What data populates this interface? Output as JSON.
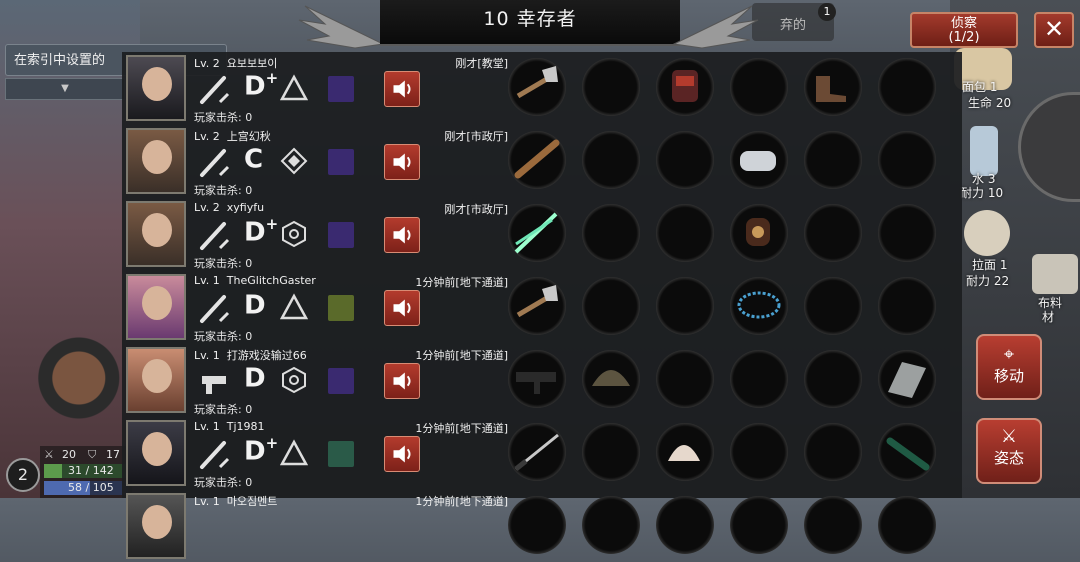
{
  "header": {
    "title": "10 幸存者"
  },
  "search": {
    "placeholder_text": "在索引中设置的",
    "dropdown_glyph": "▼"
  },
  "abandon": {
    "label": "弃的",
    "count": "1"
  },
  "recon": {
    "label": "侦察",
    "count": "(1/2)"
  },
  "close": {
    "glyph": "✕"
  },
  "survivors": [
    {
      "level": "Lv. 2",
      "name": "요보보보이",
      "location": "刚才[教堂]",
      "kills": "玩家击杀: 0",
      "grade": "D",
      "plus": "+",
      "slots": [
        "hatchet",
        "",
        "backpack",
        "",
        "boots",
        ""
      ]
    },
    {
      "level": "Lv. 2",
      "name": "上宫幻秋",
      "location": "刚才[市政厅]",
      "kills": "玩家击杀: 0",
      "grade": "C",
      "plus": "",
      "slots": [
        "bat",
        "",
        "",
        "gauntlet",
        "",
        ""
      ]
    },
    {
      "level": "Lv. 2",
      "name": "xyfiyfu",
      "location": "刚才[市政厅]",
      "kills": "玩家击杀: 0",
      "grade": "D",
      "plus": "+",
      "slots": [
        "lightsaber",
        "",
        "",
        "bracer",
        "",
        ""
      ]
    },
    {
      "level": "Lv. 1",
      "name": "TheGlitchGaster",
      "location": "1分钟前[地下通道]",
      "kills": "玩家击杀: 0",
      "grade": "D",
      "plus": "",
      "slots": [
        "hatchet",
        "",
        "",
        "necklace",
        "",
        ""
      ]
    },
    {
      "level": "Lv. 1",
      "name": "打游戏没输过66",
      "location": "1分钟前[地下通道]",
      "kills": "玩家击杀: 0",
      "grade": "D",
      "plus": "",
      "slots": [
        "smg",
        "helmet",
        "",
        "",
        "",
        "armor"
      ]
    },
    {
      "level": "Lv. 1",
      "name": "Tj1981",
      "location": "1分钟前[地下通道]",
      "kills": "玩家击杀: 0",
      "grade": "D",
      "plus": "+",
      "slots": [
        "katana",
        "",
        "hat",
        "",
        "",
        "baton"
      ]
    },
    {
      "level": "Lv. 1",
      "name": "마오짐멘트",
      "location": "1分钟前[地下通道]",
      "kills": "",
      "grade": "",
      "plus": "",
      "slots": [
        "",
        "",
        "",
        "",
        "",
        ""
      ]
    }
  ],
  "side_items": {
    "bread": {
      "name": "面包 1",
      "stat": "生命 20"
    },
    "water": {
      "name": "水 3",
      "stat": "耐力 10"
    },
    "ramen": {
      "name": "拉面 1",
      "stat": "耐力 22"
    },
    "cloth": {
      "name": "布料",
      "stat": "材"
    }
  },
  "buttons": {
    "move": "移动",
    "stance": "姿态"
  },
  "player": {
    "level": "2",
    "attack": "20",
    "defense": "17",
    "hp": "31 / 142",
    "sp": "58 / 105"
  },
  "colors": {
    "accent_red": "#a33a2c",
    "panel_bg": "#1c1e20"
  }
}
